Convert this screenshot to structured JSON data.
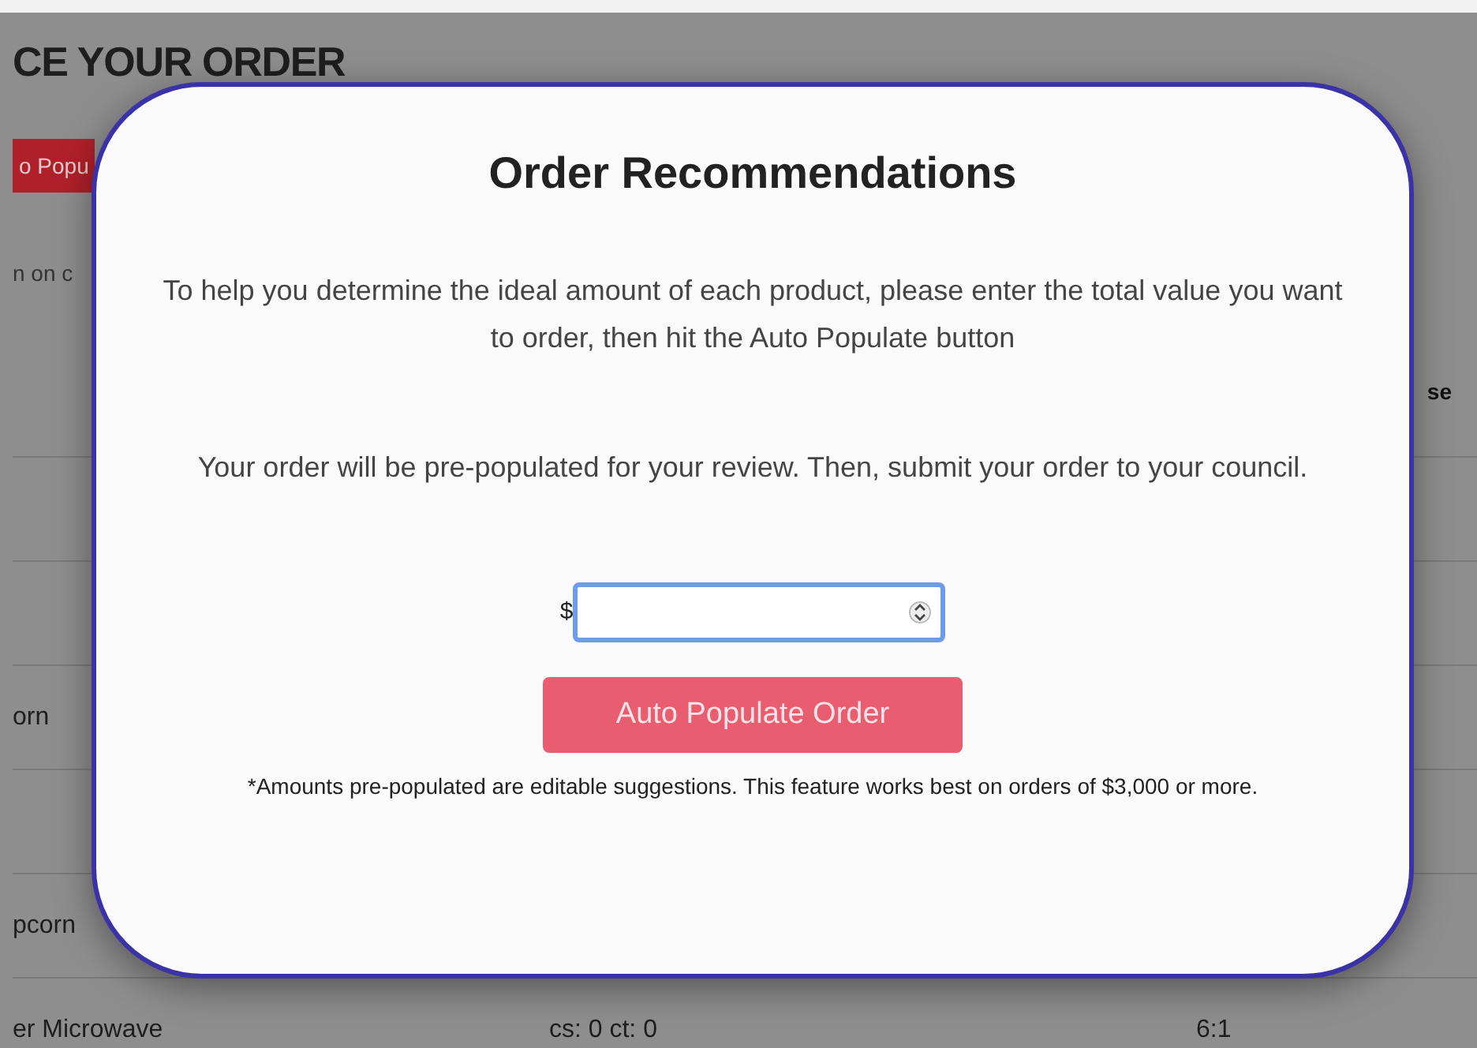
{
  "background_page": {
    "title": "CE YOUR ORDER",
    "button": "o Popu",
    "note": "n on c",
    "table": {
      "header_column_4": "se",
      "rows": [
        {},
        {},
        {
          "column_1": "orn"
        },
        {},
        {
          "column_1": "pcorn"
        },
        {
          "column_1": "er Microwave",
          "column_2": "cs: 0 ct: 0",
          "column_3": "6:1"
        }
      ]
    }
  },
  "modal": {
    "title": "Order Recommendations",
    "paragraphs": [
      "To help you determine the ideal amount of each product, please enter the total value you want to order, then hit the Auto Populate button",
      "Your order will be pre-populated for your review. Then, submit your order to your council."
    ],
    "amount_field": {
      "prefix": "$"
    },
    "button": "Auto Populate Order",
    "footnote": "*Amounts pre-populated are editable suggestions. This feature works best on orders of $3,000 or more."
  }
}
